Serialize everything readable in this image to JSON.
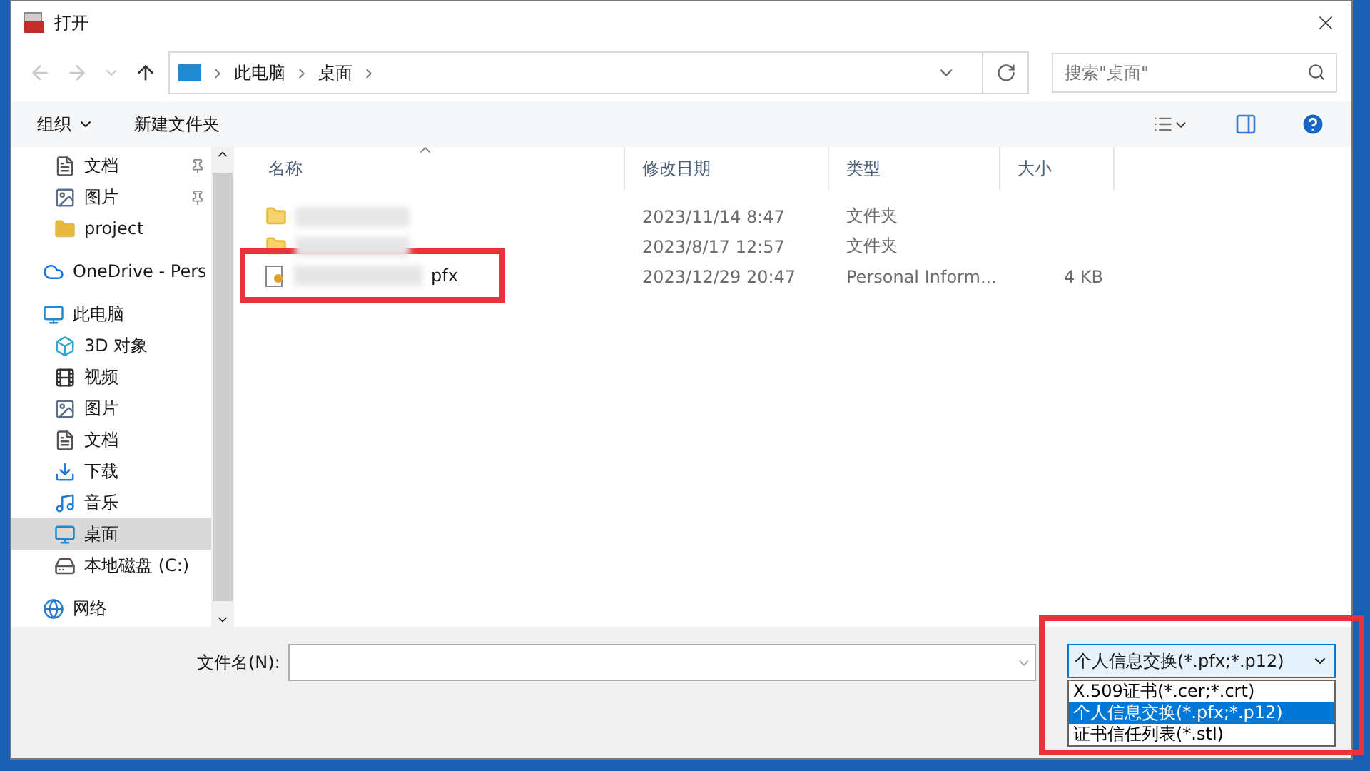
{
  "window": {
    "title": "打开"
  },
  "nav_buttons": [
    {
      "kind": "back",
      "disabled": true
    },
    {
      "kind": "forward",
      "disabled": true
    },
    {
      "kind": "recent",
      "disabled": true
    },
    {
      "kind": "up",
      "disabled": false
    }
  ],
  "address": {
    "crumbs": [
      "此电脑",
      "桌面"
    ]
  },
  "search": {
    "placeholder": "搜索\"桌面\""
  },
  "toolbar": {
    "organize": "组织",
    "new_folder": "新建文件夹"
  },
  "sidebar": {
    "items": [
      {
        "label": "文档",
        "kind": "document",
        "pinned": true,
        "selected": false
      },
      {
        "label": "图片",
        "kind": "picture",
        "pinned": true,
        "selected": false
      },
      {
        "label": "project",
        "kind": "folder",
        "pinned": false,
        "selected": false
      },
      {
        "label": "OneDrive - Pers",
        "kind": "cloud",
        "pinned": false,
        "selected": false
      },
      {
        "label": "此电脑",
        "kind": "computer",
        "pinned": false,
        "selected": false
      },
      {
        "label": "3D 对象",
        "kind": "cube",
        "pinned": false,
        "selected": false
      },
      {
        "label": "视频",
        "kind": "film",
        "pinned": false,
        "selected": false
      },
      {
        "label": "图片",
        "kind": "picture",
        "pinned": false,
        "selected": false
      },
      {
        "label": "文档",
        "kind": "document",
        "pinned": false,
        "selected": false
      },
      {
        "label": "下载",
        "kind": "download",
        "pinned": false,
        "selected": false
      },
      {
        "label": "音乐",
        "kind": "music",
        "pinned": false,
        "selected": false
      },
      {
        "label": "桌面",
        "kind": "desktop",
        "pinned": false,
        "selected": true
      },
      {
        "label": "本地磁盘 (C:)",
        "kind": "drive",
        "pinned": false,
        "selected": false
      },
      {
        "label": "网络",
        "kind": "network",
        "pinned": false,
        "selected": false
      }
    ]
  },
  "table": {
    "columns": [
      {
        "label": "名称",
        "sorted": true
      },
      {
        "label": "修改日期",
        "sorted": false
      },
      {
        "label": "类型",
        "sorted": false
      },
      {
        "label": "大小",
        "sorted": false
      }
    ],
    "rows": [
      {
        "kind": "folder",
        "date": "2023/11/14 8:47",
        "type": "文件夹"
      },
      {
        "kind": "folder",
        "date": "2023/8/17 12:57",
        "type": "文件夹"
      },
      {
        "kind": "certificate",
        "name": "pfx",
        "date": "2023/12/29 20:47",
        "type": "Personal Inform...",
        "size": "4 KB",
        "highlight": true
      }
    ]
  },
  "bottom": {
    "filename_label": "文件名(N):",
    "filetype": {
      "value": "个人信息交换(*.pfx;*.p12)",
      "expanded": true,
      "highlight": true,
      "options": [
        {
          "label": "X.509证书(*.cer;*.crt)",
          "selected": false
        },
        {
          "label": "个人信息交换(*.pfx;*.p12)",
          "selected": true
        },
        {
          "label": "证书信任列表(*.stl)",
          "selected": false
        }
      ]
    }
  }
}
